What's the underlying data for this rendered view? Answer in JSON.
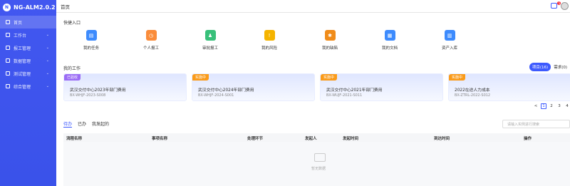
{
  "app": {
    "logo_text": "NG-ALM2.0.2",
    "logo_mark": "N"
  },
  "sidebar": {
    "items": [
      {
        "label": "首页",
        "active": true
      },
      {
        "label": "工作台"
      },
      {
        "label": "报工管理"
      },
      {
        "label": "数据管理"
      },
      {
        "label": "测试管理"
      },
      {
        "label": "综合管理"
      }
    ]
  },
  "topbar": {
    "title": "首页",
    "badge": "5"
  },
  "quick": {
    "title": "快捷入口",
    "items": [
      {
        "label": "我的任务",
        "color": "#3d8bfd"
      },
      {
        "label": "个人报工",
        "color": "#fa8c3a"
      },
      {
        "label": "审批报工",
        "color": "#38c07a"
      },
      {
        "label": "我的风险",
        "color": "#f5b400"
      },
      {
        "label": "我的缺陷",
        "color": "#f08c1a"
      },
      {
        "label": "我的文档",
        "color": "#3d8bfd"
      },
      {
        "label": "资产入库",
        "color": "#3d8bfd"
      }
    ]
  },
  "work": {
    "title": "我的工作",
    "toggle": [
      "项目(16)",
      "需求(0)"
    ],
    "cards": [
      {
        "tag": "已验收",
        "tag_color": "#9b6cf5",
        "title": "武汉交付中心2023年部门费用",
        "no": "BX-WHJF-2023-S008"
      },
      {
        "tag": "实施中",
        "tag_color": "#fa9b1a",
        "title": "武汉交付中心2024年部门费用",
        "no": "BX-WHJF-2024-S001"
      },
      {
        "tag": "实施中",
        "tag_color": "#fa9b1a",
        "title": "武汉交付中心2021年部门费用",
        "no": "BX-WUJF-2021-S011"
      },
      {
        "tag": "实施中",
        "tag_color": "#fa9b1a",
        "title": "2022在途人力成本",
        "no": "BX-ZTRL-2022-S012"
      }
    ],
    "pager": [
      "<",
      "1",
      "2",
      "3",
      "4"
    ]
  },
  "todo": {
    "tabs": [
      "待办",
      "已办",
      "我发起的"
    ],
    "search_placeholder": "请输入实例进行搜索",
    "columns": [
      "流程名称",
      "事项名称",
      "处理环节",
      "发起人",
      "发起时间",
      "到达时间",
      "操作"
    ],
    "empty": "暂无数据"
  }
}
